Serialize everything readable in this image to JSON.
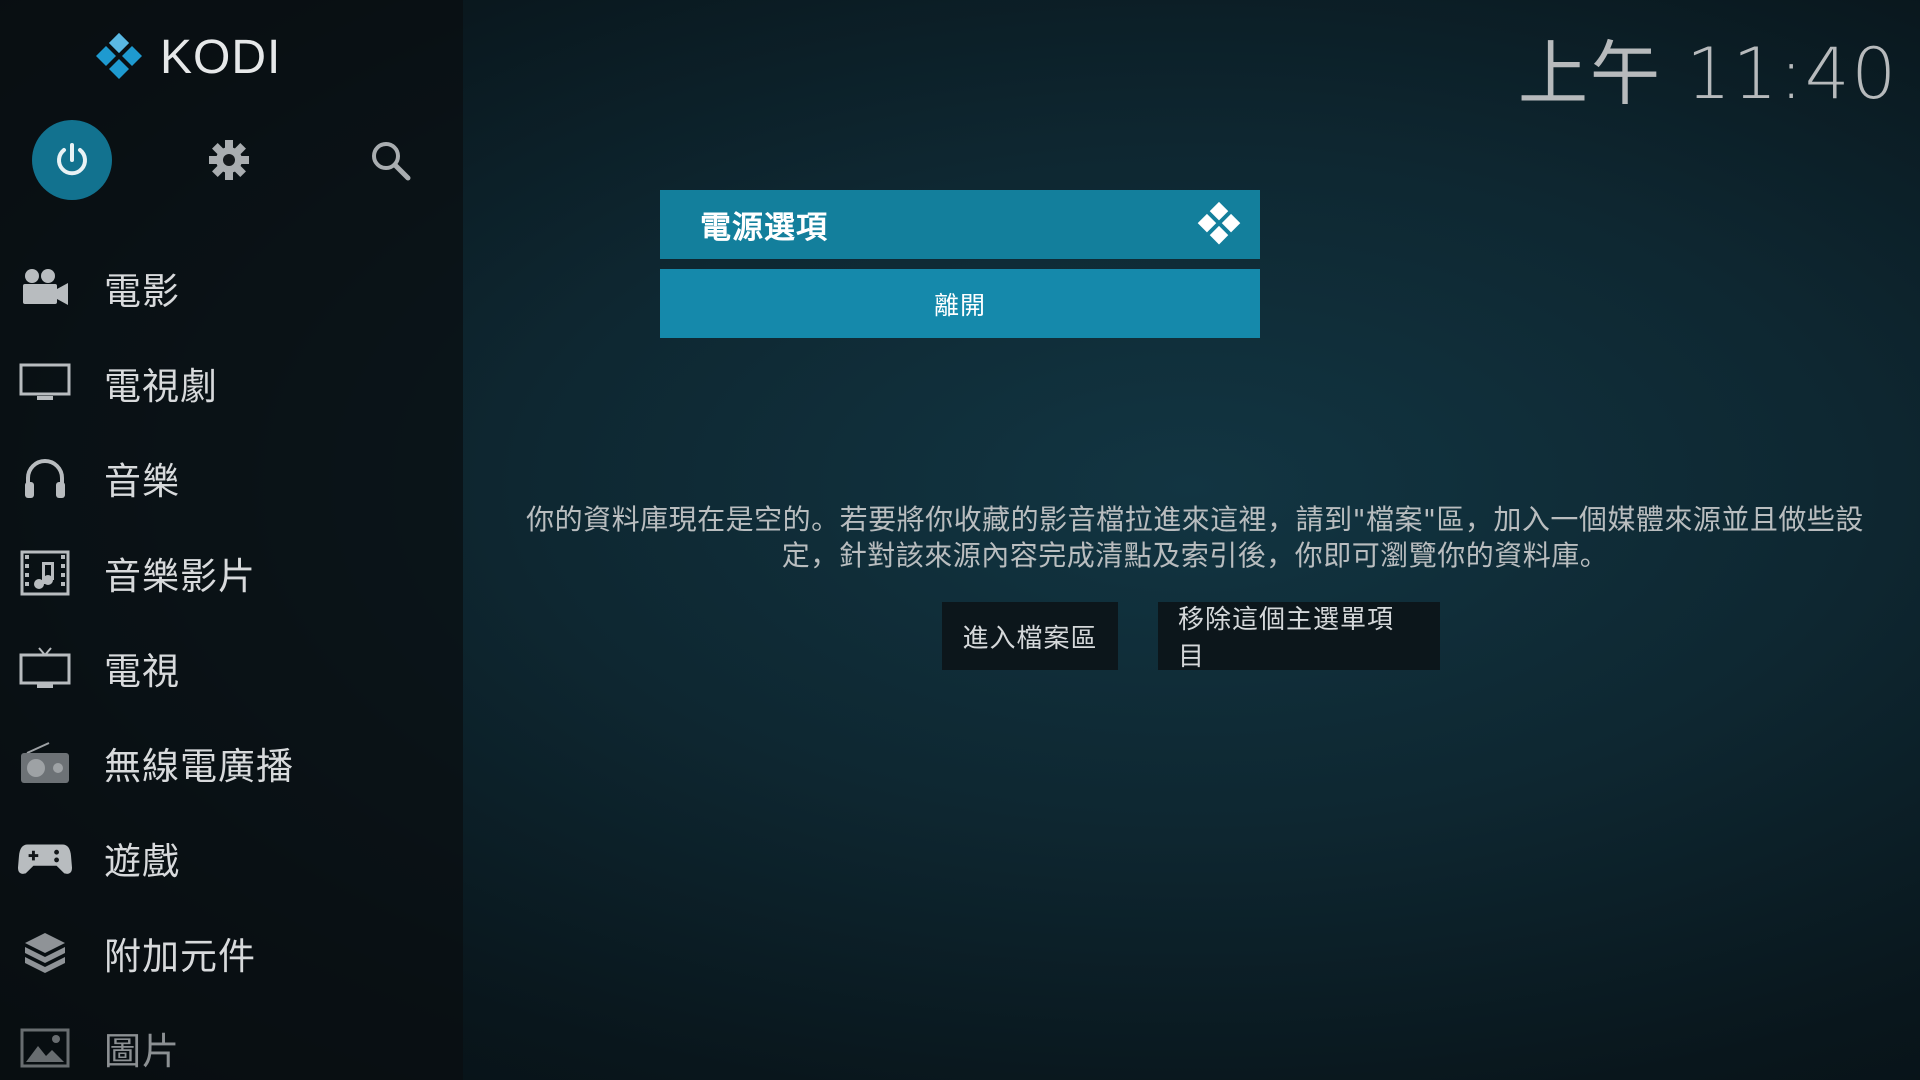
{
  "app": {
    "logo_text": "KODI"
  },
  "clock": {
    "time": "上午 11:40"
  },
  "top_actions": [
    {
      "icon": "power-icon"
    },
    {
      "icon": "gear-icon"
    },
    {
      "icon": "search-icon"
    }
  ],
  "menu": {
    "items": [
      {
        "label": "電影",
        "icon": "movie-camera-icon"
      },
      {
        "label": "電視劇",
        "icon": "monitor-icon"
      },
      {
        "label": "音樂",
        "icon": "headphones-icon"
      },
      {
        "label": "音樂影片",
        "icon": "music-video-icon"
      },
      {
        "label": "電視",
        "icon": "tv-icon"
      },
      {
        "label": "無線電廣播",
        "icon": "radio-icon"
      },
      {
        "label": "遊戲",
        "icon": "gamepad-icon"
      },
      {
        "label": "附加元件",
        "icon": "addons-box-icon"
      },
      {
        "label": "圖片",
        "icon": "picture-icon"
      }
    ]
  },
  "dialog": {
    "title": "電源選項",
    "options": [
      "離開"
    ]
  },
  "empty_library": {
    "message": "你的資料庫現在是空的。若要將你收藏的影音檔拉進來這裡，請到\"檔案\"區，加入一個媒體來源並且做些設定，針對該來源內容完成清點及索引後，你即可瀏覽你的資料庫。",
    "buttons": [
      "進入檔案區",
      "移除這個主選單項目"
    ]
  },
  "colors": {
    "accent": "#12728f",
    "dialog_header": "#137f9c",
    "dialog_option": "#1589ab"
  }
}
